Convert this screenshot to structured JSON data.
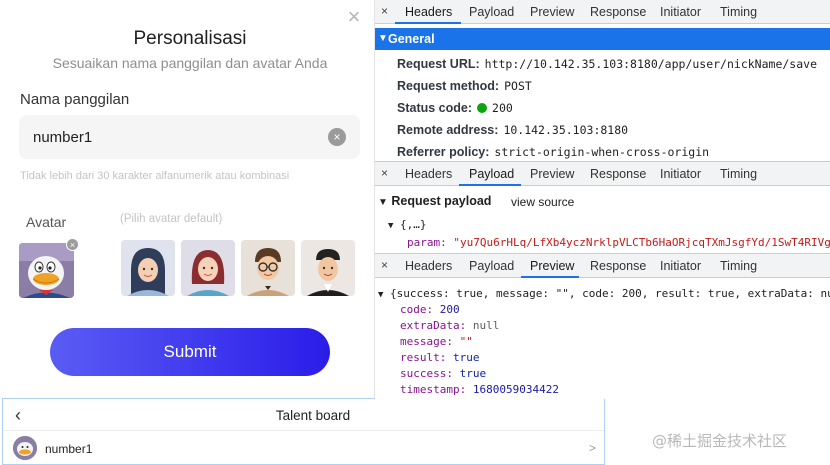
{
  "modal": {
    "title": "Personalisasi",
    "subtitle": "Sesuaikan nama panggilan dan avatar Anda",
    "close_symbol": "×",
    "nickname_label": "Nama panggilan",
    "nickname_value": "number1",
    "nickname_hint": "Tidak lebih dari 30 karakter alfanumerik atau kombinasi",
    "clear_symbol": "×",
    "avatar_label": "Avatar",
    "avatar_hint": "(Pilih avatar default)",
    "default_avatars": [
      "hijab-avatar",
      "woman-avatar",
      "glasses-man-avatar",
      "cap-man-avatar"
    ],
    "submit_label": "Submit"
  },
  "drawer": {
    "back_symbol": "‹",
    "title": "Talent board",
    "row_name": "number1",
    "row_chevron": ">"
  },
  "devtools": {
    "panel1": {
      "close": "×",
      "tabs": [
        "Headers",
        "Payload",
        "Preview",
        "Response",
        "Initiator",
        "Timing"
      ],
      "active_tab": "Headers",
      "general_title": "General",
      "rows": [
        {
          "key": "Request URL:",
          "value": "http://10.142.35.103:8180/app/user/nickName/save"
        },
        {
          "key": "Request method:",
          "value": "POST"
        },
        {
          "key": "Status code:",
          "value": "200"
        },
        {
          "key": "Remote address:",
          "value": "10.142.35.103:8180"
        },
        {
          "key": "Referrer policy:",
          "value": "strict-origin-when-cross-origin"
        }
      ]
    },
    "panel2": {
      "close": "×",
      "tabs": [
        "Headers",
        "Payload",
        "Preview",
        "Response",
        "Initiator",
        "Timing"
      ],
      "active_tab": "Payload",
      "section_title": "Request payload",
      "view_source": "view source",
      "obj_summary": "{,…}",
      "param_key": "param:",
      "param_value": "\"yu7Qu6rHLq/LfXb4yczNrklpVLCTb6HaORjcqTXmJsgfYd/1SwT4RIVg"
    },
    "panel3": {
      "close": "×",
      "tabs": [
        "Headers",
        "Payload",
        "Preview",
        "Response",
        "Initiator",
        "Timing"
      ],
      "active_tab": "Preview",
      "summary": "{success: true, message: \"\", code: 200, result: true, extraData: nu",
      "fields": [
        {
          "key": "code:",
          "value": "200",
          "type": "num"
        },
        {
          "key": "extraData:",
          "value": "null",
          "type": "grey"
        },
        {
          "key": "message:",
          "value": "\"\"",
          "type": "str"
        },
        {
          "key": "result:",
          "value": "true",
          "type": "bool"
        },
        {
          "key": "success:",
          "value": "true",
          "type": "bool"
        },
        {
          "key": "timestamp:",
          "value": "1680059034422",
          "type": "num"
        }
      ]
    }
  },
  "watermark": "@稀土掘金技术社区",
  "colors": {
    "accent_blue": "#1a73e8",
    "submit_start": "#5a5cf4",
    "submit_end": "#2a1de9",
    "status_green": "#0ca30c"
  }
}
